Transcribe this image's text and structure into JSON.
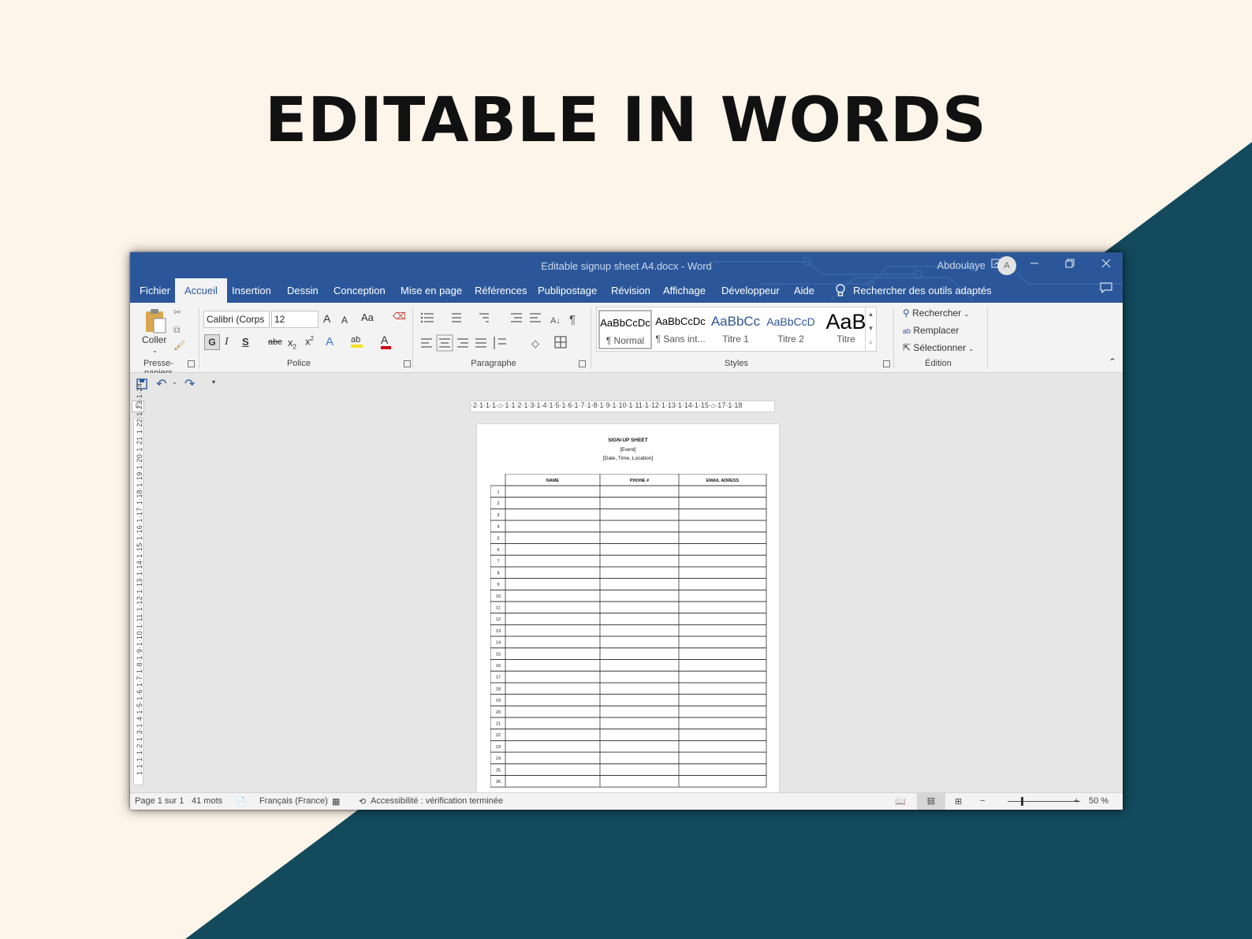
{
  "headline": "EDITABLE IN WORDS",
  "colors": {
    "background": "#fdf5e9",
    "teal": "#134a5e",
    "word_blue": "#2b579a"
  },
  "window": {
    "title": "Editable signup sheet A4.docx  -  Word",
    "user": "Abdoulaye",
    "avatar_initial": "A",
    "buttons": [
      "ribbon-display-icon",
      "minimize-icon",
      "restore-icon",
      "close-icon"
    ]
  },
  "tabs": [
    "Fichier",
    "Accueil",
    "Insertion",
    "Dessin",
    "Conception",
    "Mise en page",
    "Références",
    "Publipostage",
    "Révision",
    "Affichage",
    "Développeur",
    "Aide"
  ],
  "active_tab": "Accueil",
  "tell_me": "Rechercher des outils adaptés",
  "ribbon": {
    "clipboard": {
      "paste": "Coller",
      "label": "Presse-papiers"
    },
    "font": {
      "name": "Calibri (Corps",
      "size": "12",
      "label": "Police",
      "bold": "G",
      "italic": "I",
      "underline": "S",
      "strike": "abc",
      "change_case": "Aa",
      "grow": "A",
      "shrink": "A"
    },
    "paragraph": {
      "label": "Paragraphe"
    },
    "styles": {
      "label": "Styles",
      "items": [
        {
          "preview": "AaBbCcDc",
          "name": "¶ Normal"
        },
        {
          "preview": "AaBbCcDc",
          "name": "¶ Sans int..."
        },
        {
          "preview": "AaBbCc",
          "name": "Titre 1"
        },
        {
          "preview": "AaBbCcD",
          "name": "Titre 2"
        },
        {
          "preview": "AaB",
          "name": "Titre"
        }
      ]
    },
    "editing": {
      "label": "Édition",
      "find": "Rechercher",
      "replace": "Remplacer",
      "select": "Sélectionner"
    }
  },
  "ruler": {
    "horizontal": "·2·1·1·1·⌂·1·1·2·1·3·1·4·1·5·1·6·1·7·1·8·1·9·1·10·1·11·1·12·1·13·1·14·1·15·⌂·17·1·18",
    "vertical": "1·1·1·1·2·1·3·1·4·1·5·1·6·1·7·1·8·1·9·1·10·1·11·1·12·1·13·1·14·1·15·1·16·1·17·1·18·1·19·1·20·1·21·1·22·1·23·1·24"
  },
  "document": {
    "title": "SIGN-UP SHEET",
    "event": "[Event]",
    "details": "[Date, Time, Location]",
    "columns": [
      "NAME",
      "PHONE #",
      "EMAIL ADRESS"
    ],
    "rows": [
      "1",
      "2",
      "3",
      "4",
      "5",
      "6",
      "7",
      "8",
      "9",
      "10",
      "11",
      "12",
      "13",
      "14",
      "15",
      "16",
      "17",
      "18",
      "19",
      "20",
      "21",
      "22",
      "23",
      "24",
      "25",
      "26"
    ]
  },
  "status": {
    "page": "Page 1 sur 1",
    "words": "41 mots",
    "language": "Français (France)",
    "accessibility": "Accessibilité : vérification terminée",
    "zoom": "50 %",
    "zoom_minus": "−",
    "zoom_plus": "+"
  }
}
